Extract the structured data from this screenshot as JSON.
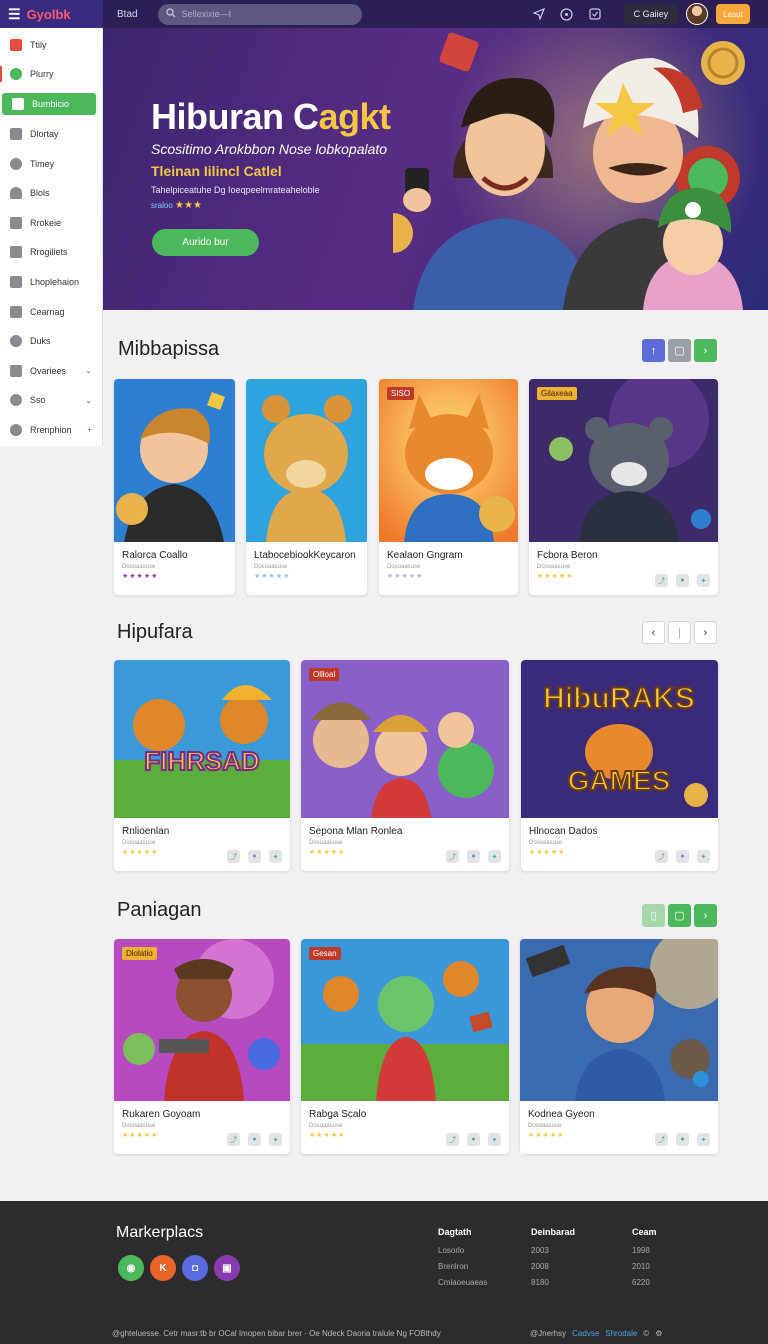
{
  "header": {
    "brand": "Gyolbk",
    "nav_link": "Btad",
    "search_placeholder": "Sellexixie—I",
    "gallery_label": "C Gaiiey",
    "cta_label": "Lasut"
  },
  "sidebar": {
    "items": [
      {
        "label": "Ttily"
      },
      {
        "label": "Plurry"
      },
      {
        "label": "Bumbicio"
      },
      {
        "label": "Dlortay"
      },
      {
        "label": "Timey"
      },
      {
        "label": "Blols"
      },
      {
        "label": "Rrokeie"
      },
      {
        "label": "Rrogiliets"
      },
      {
        "label": "Lhoplehaion"
      },
      {
        "label": "Cearnag"
      },
      {
        "label": "Duks"
      },
      {
        "label": "Ovariees"
      },
      {
        "label": "Sso"
      },
      {
        "label": "Rrenphion"
      }
    ]
  },
  "hero": {
    "title_a": "Hiburan C",
    "title_b": "agkt",
    "subtitle": "Scositimo Arokbbon Nose lobkopalato",
    "tagline": "Tleinan Iilincl Catlel",
    "description": "Tahelpiceatuhe Dg Ioeqpeelmrateaheloble",
    "rating_label": "sraloo",
    "rating_stars": "★★★",
    "cta": "Aurido bur"
  },
  "section1": {
    "title": "Mibbapissa",
    "cards": [
      {
        "name": "Ralorca Coallo",
        "meta": "Dosoaasuse",
        "stars": "★★★★★",
        "star_color": "#8e44ad"
      },
      {
        "name": "LtabocebiookKeycaron",
        "meta": "Dosoaasuse",
        "stars": "★★★★★",
        "star_color": "#8fc3ea"
      },
      {
        "name": "Kealaon Gngram",
        "meta": "Dosoaasuse",
        "stars": "★★★★★",
        "star_color": "#b8b8d8",
        "tag": "SISO"
      },
      {
        "name": "Fcbora Beron",
        "meta": "Dosoaasuse",
        "stars": "★★★★★",
        "star_color": "#f6c744",
        "tag": "Gilaxeaa"
      }
    ]
  },
  "section2": {
    "title": "Hipufara",
    "cards": [
      {
        "name": "Rnlioenlan",
        "meta": "Dosoaasuse",
        "stars": "★★★★★",
        "star_color": "#f6c744",
        "art_text": "FIHRSAD"
      },
      {
        "name": "Sepona Mlan Ronlea",
        "meta": "Dosoaasuse",
        "stars": "★★★★★",
        "star_color": "#f6c744",
        "tag": "Ollloal"
      },
      {
        "name": "Hlnocan Dados",
        "meta": "Dosoaasuse",
        "stars": "★★★★★",
        "star_color": "#f6c744",
        "art_text": "HibuRAKS",
        "art_text2": "GAMES"
      }
    ]
  },
  "section3": {
    "title": "Paniagan",
    "cards": [
      {
        "name": "Rukaren Goyoam",
        "meta": "Dosoaasuse",
        "stars": "★★★★★",
        "star_color": "#f6c744",
        "tag": "Dlolatio"
      },
      {
        "name": "Rabga Scalo",
        "meta": "Dosoaasuse",
        "stars": "★★★★★",
        "star_color": "#f6c744",
        "tag": "Gesan"
      },
      {
        "name": "Kodnea Gyeon",
        "meta": "Dosoaasuse",
        "stars": "★★★★★",
        "star_color": "#f6c744"
      }
    ]
  },
  "footer": {
    "title": "Markerplacs",
    "columns": [
      {
        "heading": "Dagtath",
        "rows": [
          "Losorlo",
          "Brenlron",
          "Cmlaoeuaeas"
        ]
      },
      {
        "heading": "Deinbarad",
        "rows": [
          "2003",
          "2008",
          "8180"
        ]
      },
      {
        "heading": "Ceam",
        "rows": [
          "1998",
          "2010",
          "6220"
        ]
      }
    ],
    "copyright": "@ghteluesse. Cetr masr.tb br OCal Imopen bibar brer  · Oe Ndeck Daoria tralule Ng FOBthdy",
    "bottom_right": [
      "@Jnerhsy",
      "Cadvse",
      "Shrodale"
    ]
  }
}
